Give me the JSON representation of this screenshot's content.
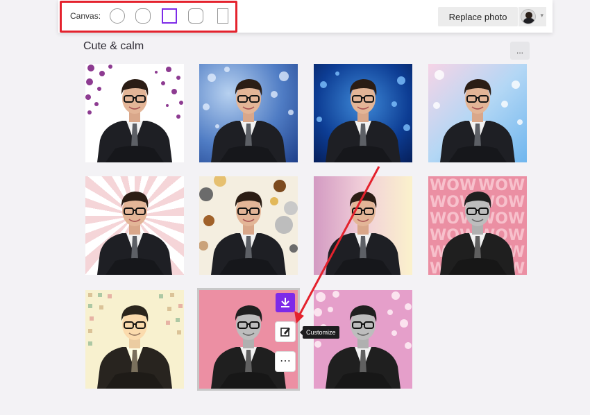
{
  "toolbar": {
    "canvas_label": "Canvas:",
    "shapes": [
      "circle",
      "rounded-circle",
      "square",
      "rounded-square",
      "portrait"
    ],
    "selected_shape": "square",
    "replace_label": "Replace photo",
    "avatar_caret": "▾"
  },
  "section": {
    "title": "Cute & calm",
    "more_label": "..."
  },
  "tile_actions": {
    "more_label": "⋯",
    "tooltip": "Customize"
  },
  "colors": {
    "accent": "#7d2ae8",
    "highlight": "#e4222d"
  },
  "tiles": [
    {
      "style": "purple-polka-dots"
    },
    {
      "style": "blue-bokeh"
    },
    {
      "style": "deep-blue-bokeh"
    },
    {
      "style": "pastel-blue-bokeh"
    },
    {
      "style": "pink-sunburst-sticker"
    },
    {
      "style": "brown-dots-sticker"
    },
    {
      "style": "pink-yellow-gradient"
    },
    {
      "style": "pink-wow-text-bw"
    },
    {
      "style": "sepia-squares"
    },
    {
      "style": "pink-bw-selected"
    },
    {
      "style": "pink-circles-bw"
    }
  ]
}
